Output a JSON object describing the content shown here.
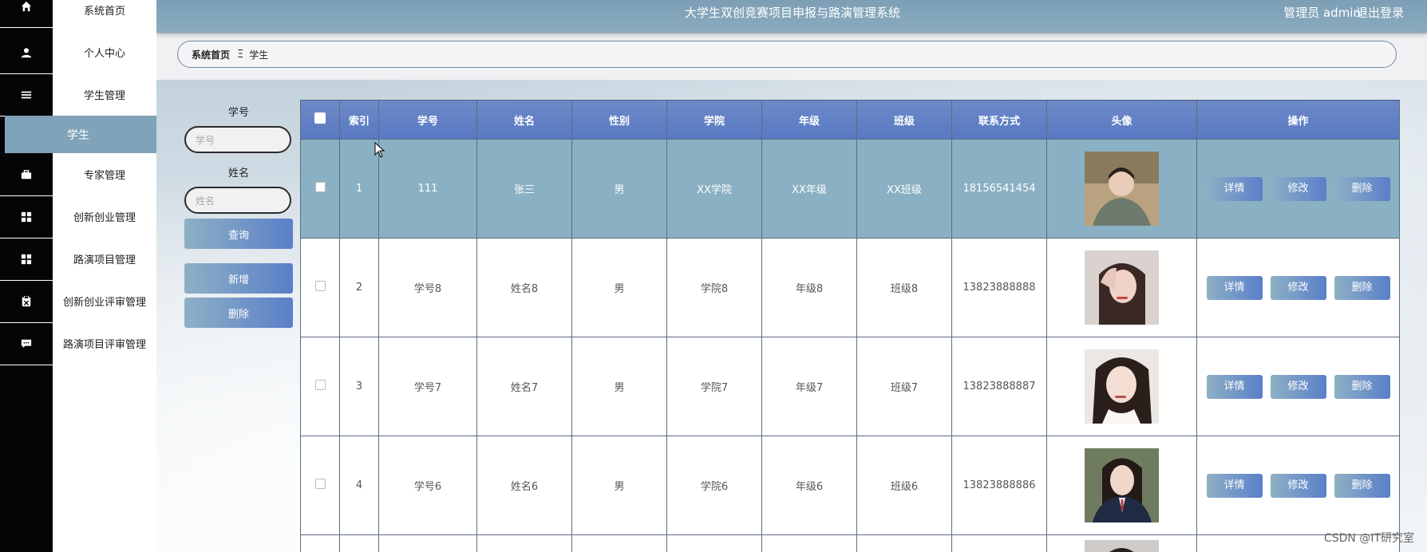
{
  "header": {
    "title": "大学生双创竞赛项目申报与路演管理系统",
    "admin_label": "管理员 admin",
    "logout_label": "退出登录"
  },
  "sidebar": {
    "items": [
      {
        "label": "系统首页",
        "icon": "home-icon"
      },
      {
        "label": "个人中心",
        "icon": "user-icon"
      },
      {
        "label": "学生管理",
        "icon": "list-icon"
      },
      {
        "label": "专家管理",
        "icon": "briefcase-icon"
      },
      {
        "label": "创新创业管理",
        "icon": "grid-icon"
      },
      {
        "label": "路演项目管理",
        "icon": "grid-icon"
      },
      {
        "label": "创新创业评审管理",
        "icon": "clipboard-icon"
      },
      {
        "label": "路演项目评审管理",
        "icon": "chat-icon"
      }
    ],
    "active_sub": "学生"
  },
  "breadcrumb": {
    "home": "系统首页",
    "separator": "Ξ",
    "current": "学生"
  },
  "search": {
    "xuehao_label": "学号",
    "xuehao_placeholder": "学号",
    "xingming_label": "姓名",
    "xingming_placeholder": "姓名",
    "query_button": "查询",
    "add_button": "新增",
    "delete_button": "删除"
  },
  "table": {
    "columns": [
      "索引",
      "学号",
      "姓名",
      "性别",
      "学院",
      "年级",
      "班级",
      "联系方式",
      "头像",
      "操作"
    ],
    "rows": [
      {
        "index": "1",
        "xuehao": "111",
        "name": "张三",
        "gender": "男",
        "college": "XX学院",
        "grade": "XX年级",
        "class": "XX班级",
        "phone": "18156541454"
      },
      {
        "index": "2",
        "xuehao": "学号8",
        "name": "姓名8",
        "gender": "男",
        "college": "学院8",
        "grade": "年级8",
        "class": "班级8",
        "phone": "13823888888"
      },
      {
        "index": "3",
        "xuehao": "学号7",
        "name": "姓名7",
        "gender": "男",
        "college": "学院7",
        "grade": "年级7",
        "class": "班级7",
        "phone": "13823888887"
      },
      {
        "index": "4",
        "xuehao": "学号6",
        "name": "姓名6",
        "gender": "男",
        "college": "学院6",
        "grade": "年级6",
        "class": "班级6",
        "phone": "13823888886"
      }
    ],
    "actions": {
      "detail": "详情",
      "edit": "修改",
      "delete": "删除"
    }
  },
  "watermark": "CSDN @IT研究室",
  "colors": {
    "header": "#7c9fb5",
    "accent": "#5a7fc9",
    "table_header": "#5878c2",
    "selected_row": "#8ab0c3"
  }
}
